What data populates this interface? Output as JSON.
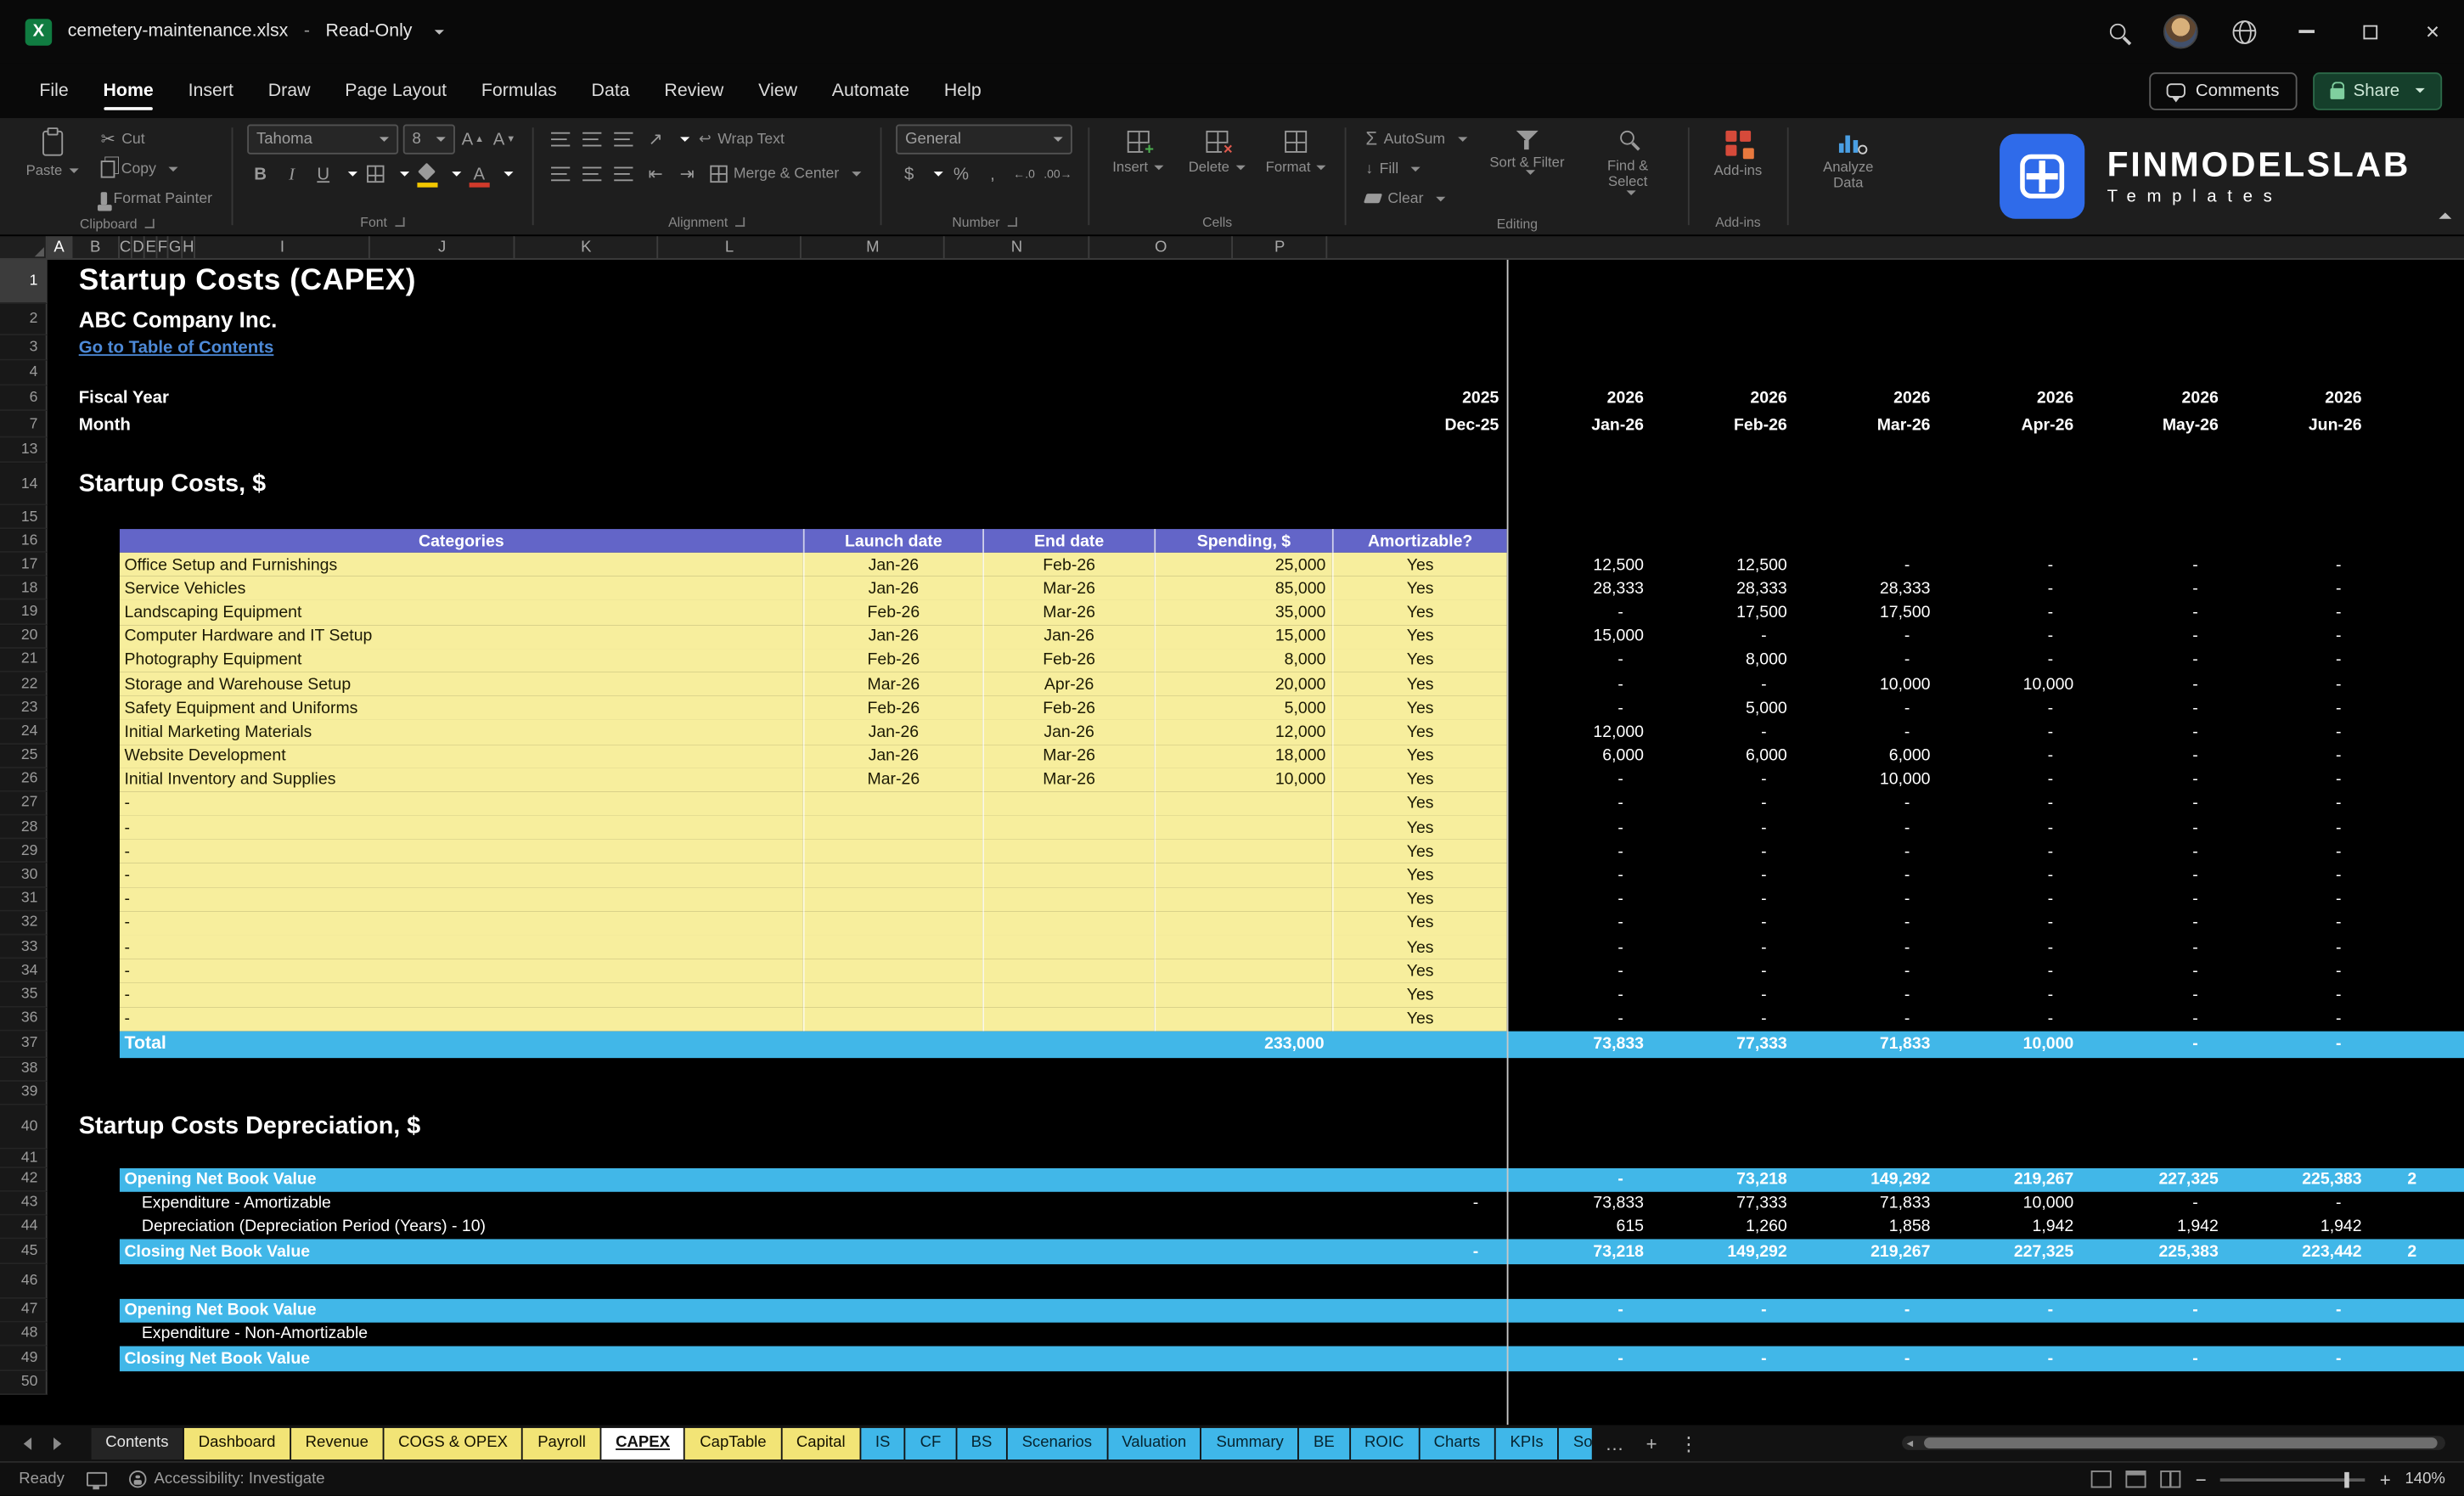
{
  "titlebar": {
    "filename": "cemetery-maintenance.xlsx",
    "separator": "-",
    "mode": "Read-Only"
  },
  "menu": {
    "items": [
      "File",
      "Home",
      "Insert",
      "Draw",
      "Page Layout",
      "Formulas",
      "Data",
      "Review",
      "View",
      "Automate",
      "Help"
    ],
    "active": "Home",
    "comments_label": "Comments",
    "share_label": "Share"
  },
  "ribbon": {
    "paste": "Paste",
    "cut": "Cut",
    "copy": "Copy",
    "format_painter": "Format Painter",
    "font_name": "Tahoma",
    "font_size": "8",
    "wrap_text": "Wrap Text",
    "merge_center": "Merge & Center",
    "number_format": "General",
    "insert": "Insert",
    "delete": "Delete",
    "format": "Format",
    "autosum": "AutoSum",
    "fill": "Fill",
    "clear": "Clear",
    "sort_filter": "Sort & Filter",
    "find_select": "Find & Select",
    "addins": "Add-ins",
    "analyze": "Analyze Data",
    "groups": [
      "Clipboard",
      "Font",
      "Alignment",
      "Number",
      "Cells",
      "Editing",
      "Add-ins"
    ]
  },
  "brand": {
    "line1": "FINMODELSLAB",
    "line2": "Templates"
  },
  "colors": {
    "accent_yellow": "#f7ee9d",
    "accent_purple": "#6365c8",
    "accent_blue": "#41b7e8",
    "excel_green": "#107c41"
  },
  "sheet": {
    "columns": [
      "A",
      "B",
      "C",
      "D",
      "E",
      "F",
      "G",
      "H",
      "I",
      "J",
      "K",
      "L",
      "M",
      "N",
      "O",
      "P"
    ],
    "rows": [
      {
        "n": "1",
        "h": 28,
        "t": "title",
        "text": "Startup Costs (CAPEX)"
      },
      {
        "n": "2",
        "h": 20,
        "t": "company",
        "text": "ABC Company Inc."
      },
      {
        "n": "3",
        "h": 16,
        "t": "link",
        "text": "Go to Table of Contents"
      },
      {
        "n": "4",
        "h": 16,
        "t": "blank"
      },
      {
        "n": "6",
        "h": 16,
        "t": "years",
        "label": "Fiscal Year",
        "i": "2025",
        "vals": [
          "2026",
          "2026",
          "2026",
          "2026",
          "2026",
          "2026"
        ]
      },
      {
        "n": "7",
        "h": 17,
        "t": "years",
        "label": "Month",
        "i": "Dec-25",
        "vals": [
          "Jan-26",
          "Feb-26",
          "Mar-26",
          "Apr-26",
          "May-26",
          "Jun-26"
        ]
      },
      {
        "n": "13",
        "h": 16,
        "t": "blank"
      },
      {
        "n": "14",
        "h": 27,
        "t": "section",
        "text": "Startup Costs, $"
      },
      {
        "n": "15",
        "h": 15,
        "t": "blank"
      },
      {
        "n": "16",
        "h": 15,
        "t": "thead",
        "cols": [
          "Categories",
          "Launch date",
          "End date",
          "Spending, $",
          "Amortizable?"
        ]
      },
      {
        "n": "17",
        "h": 15.2,
        "t": "item",
        "name": "Office Setup and Furnishings",
        "launch": "Jan-26",
        "end": "Feb-26",
        "spend": "25,000",
        "amort": "Yes",
        "vals": [
          "12,500",
          "12,500",
          "-",
          "-",
          "-",
          "-"
        ]
      },
      {
        "n": "18",
        "h": 15.2,
        "t": "item",
        "name": "Service Vehicles",
        "launch": "Jan-26",
        "end": "Mar-26",
        "spend": "85,000",
        "amort": "Yes",
        "vals": [
          "28,333",
          "28,333",
          "28,333",
          "-",
          "-",
          "-"
        ]
      },
      {
        "n": "19",
        "h": 15.2,
        "t": "item",
        "name": "Landscaping Equipment",
        "launch": "Feb-26",
        "end": "Mar-26",
        "spend": "35,000",
        "amort": "Yes",
        "vals": [
          "-",
          "17,500",
          "17,500",
          "-",
          "-",
          "-"
        ]
      },
      {
        "n": "20",
        "h": 15.2,
        "t": "item",
        "name": "Computer Hardware and IT Setup",
        "launch": "Jan-26",
        "end": "Jan-26",
        "spend": "15,000",
        "amort": "Yes",
        "vals": [
          "15,000",
          "-",
          "-",
          "-",
          "-",
          "-"
        ]
      },
      {
        "n": "21",
        "h": 15.2,
        "t": "item",
        "name": "Photography Equipment",
        "launch": "Feb-26",
        "end": "Feb-26",
        "spend": "8,000",
        "amort": "Yes",
        "vals": [
          "-",
          "8,000",
          "-",
          "-",
          "-",
          "-"
        ]
      },
      {
        "n": "22",
        "h": 15.2,
        "t": "item",
        "name": "Storage and Warehouse Setup",
        "launch": "Mar-26",
        "end": "Apr-26",
        "spend": "20,000",
        "amort": "Yes",
        "vals": [
          "-",
          "-",
          "10,000",
          "10,000",
          "-",
          "-"
        ]
      },
      {
        "n": "23",
        "h": 15.2,
        "t": "item",
        "name": "Safety Equipment and Uniforms",
        "launch": "Feb-26",
        "end": "Feb-26",
        "spend": "5,000",
        "amort": "Yes",
        "vals": [
          "-",
          "5,000",
          "-",
          "-",
          "-",
          "-"
        ]
      },
      {
        "n": "24",
        "h": 15.2,
        "t": "item",
        "name": "Initial Marketing Materials",
        "launch": "Jan-26",
        "end": "Jan-26",
        "spend": "12,000",
        "amort": "Yes",
        "vals": [
          "12,000",
          "-",
          "-",
          "-",
          "-",
          "-"
        ]
      },
      {
        "n": "25",
        "h": 15.2,
        "t": "item",
        "name": "Website Development",
        "launch": "Jan-26",
        "end": "Mar-26",
        "spend": "18,000",
        "amort": "Yes",
        "vals": [
          "6,000",
          "6,000",
          "6,000",
          "-",
          "-",
          "-"
        ]
      },
      {
        "n": "26",
        "h": 15.2,
        "t": "item",
        "name": "Initial Inventory and Supplies",
        "launch": "Mar-26",
        "end": "Mar-26",
        "spend": "10,000",
        "amort": "Yes",
        "vals": [
          "-",
          "-",
          "10,000",
          "-",
          "-",
          "-"
        ]
      },
      {
        "n": "27",
        "h": 15.2,
        "t": "item",
        "name": "-",
        "launch": "",
        "end": "",
        "spend": "",
        "amort": "Yes",
        "vals": [
          "-",
          "-",
          "-",
          "-",
          "-",
          "-"
        ]
      },
      {
        "n": "28",
        "h": 15.2,
        "t": "item",
        "name": "-",
        "launch": "",
        "end": "",
        "spend": "",
        "amort": "Yes",
        "vals": [
          "-",
          "-",
          "-",
          "-",
          "-",
          "-"
        ]
      },
      {
        "n": "29",
        "h": 15.2,
        "t": "item",
        "name": "-",
        "launch": "",
        "end": "",
        "spend": "",
        "amort": "Yes",
        "vals": [
          "-",
          "-",
          "-",
          "-",
          "-",
          "-"
        ]
      },
      {
        "n": "30",
        "h": 15.2,
        "t": "item",
        "name": "-",
        "launch": "",
        "end": "",
        "spend": "",
        "amort": "Yes",
        "vals": [
          "-",
          "-",
          "-",
          "-",
          "-",
          "-"
        ]
      },
      {
        "n": "31",
        "h": 15.2,
        "t": "item",
        "name": "-",
        "launch": "",
        "end": "",
        "spend": "",
        "amort": "Yes",
        "vals": [
          "-",
          "-",
          "-",
          "-",
          "-",
          "-"
        ]
      },
      {
        "n": "32",
        "h": 15.2,
        "t": "item",
        "name": "-",
        "launch": "",
        "end": "",
        "spend": "",
        "amort": "Yes",
        "vals": [
          "-",
          "-",
          "-",
          "-",
          "-",
          "-"
        ]
      },
      {
        "n": "33",
        "h": 15.2,
        "t": "item",
        "name": "-",
        "launch": "",
        "end": "",
        "spend": "",
        "amort": "Yes",
        "vals": [
          "-",
          "-",
          "-",
          "-",
          "-",
          "-"
        ]
      },
      {
        "n": "34",
        "h": 15.2,
        "t": "item",
        "name": "-",
        "launch": "",
        "end": "",
        "spend": "",
        "amort": "Yes",
        "vals": [
          "-",
          "-",
          "-",
          "-",
          "-",
          "-"
        ]
      },
      {
        "n": "35",
        "h": 15.2,
        "t": "item",
        "name": "-",
        "launch": "",
        "end": "",
        "spend": "",
        "amort": "Yes",
        "vals": [
          "-",
          "-",
          "-",
          "-",
          "-",
          "-"
        ]
      },
      {
        "n": "36",
        "h": 15.2,
        "t": "item",
        "name": "-",
        "launch": "",
        "end": "",
        "spend": "",
        "amort": "Yes",
        "vals": [
          "-",
          "-",
          "-",
          "-",
          "-",
          "-"
        ]
      },
      {
        "n": "37",
        "h": 17,
        "t": "total",
        "label": "Total",
        "spend": "233,000",
        "vals": [
          "73,833",
          "77,333",
          "71,833",
          "10,000",
          "-",
          "-"
        ]
      },
      {
        "n": "38",
        "h": 15,
        "t": "blank"
      },
      {
        "n": "39",
        "h": 15,
        "t": "blank"
      },
      {
        "n": "40",
        "h": 28,
        "t": "section",
        "text": "Startup Costs Depreciation, $"
      },
      {
        "n": "41",
        "h": 12,
        "t": "blank"
      },
      {
        "n": "42",
        "h": 15,
        "t": "band",
        "label": "Opening Net Book Value",
        "i": "",
        "vals": [
          "-",
          "73,218",
          "149,292",
          "219,267",
          "227,325",
          "225,383"
        ],
        "partial": "2"
      },
      {
        "n": "43",
        "h": 15,
        "t": "plain",
        "label": "Expenditure - Amortizable",
        "i": "-",
        "vals": [
          "73,833",
          "77,333",
          "71,833",
          "10,000",
          "-",
          "-"
        ]
      },
      {
        "n": "44",
        "h": 15,
        "t": "plain",
        "label": "Depreciation (Depreciation Period (Years) - 10)",
        "i": "",
        "vals": [
          "615",
          "1,260",
          "1,858",
          "1,942",
          "1,942",
          "1,942"
        ]
      },
      {
        "n": "45",
        "h": 16,
        "t": "band",
        "label": "Closing Net Book Value",
        "i": "-",
        "vals": [
          "73,218",
          "149,292",
          "219,267",
          "227,325",
          "225,383",
          "223,442"
        ],
        "partial": "2"
      },
      {
        "n": "46",
        "h": 22,
        "t": "blank"
      },
      {
        "n": "47",
        "h": 15,
        "t": "band",
        "label": "Opening Net Book Value",
        "i": "",
        "vals": [
          "-",
          "-",
          "-",
          "-",
          "-",
          "-"
        ]
      },
      {
        "n": "48",
        "h": 15,
        "t": "plain",
        "label": "Expenditure - Non-Amortizable",
        "i": "",
        "vals": [
          "",
          "",
          "",
          "",
          "",
          ""
        ]
      },
      {
        "n": "49",
        "h": 16,
        "t": "band",
        "label": "Closing Net Book Value",
        "i": "",
        "vals": [
          "-",
          "-",
          "-",
          "-",
          "-",
          "-"
        ]
      },
      {
        "n": "50",
        "h": 15,
        "t": "blank"
      }
    ]
  },
  "tabs": [
    {
      "label": "Contents",
      "style": "dark"
    },
    {
      "label": "Dashboard",
      "style": "yellow"
    },
    {
      "label": "Revenue",
      "style": "yellow"
    },
    {
      "label": "COGS & OPEX",
      "style": "yellow"
    },
    {
      "label": "Payroll",
      "style": "yellow"
    },
    {
      "label": "CAPEX",
      "style": "active"
    },
    {
      "label": "CapTable",
      "style": "yellow"
    },
    {
      "label": "Capital",
      "style": "yellow"
    },
    {
      "label": "IS",
      "style": "blue"
    },
    {
      "label": "CF",
      "style": "blue"
    },
    {
      "label": "BS",
      "style": "blue"
    },
    {
      "label": "Scenarios",
      "style": "blue"
    },
    {
      "label": "Valuation",
      "style": "blue"
    },
    {
      "label": "Summary",
      "style": "blue"
    },
    {
      "label": "BE",
      "style": "blue"
    },
    {
      "label": "ROIC",
      "style": "blue"
    },
    {
      "label": "Charts",
      "style": "blue"
    },
    {
      "label": "KPIs",
      "style": "blue"
    },
    {
      "label": "So",
      "style": "blue",
      "clip": true
    }
  ],
  "statusbar": {
    "ready": "Ready",
    "accessibility": "Accessibility: Investigate",
    "zoom": "140%"
  }
}
